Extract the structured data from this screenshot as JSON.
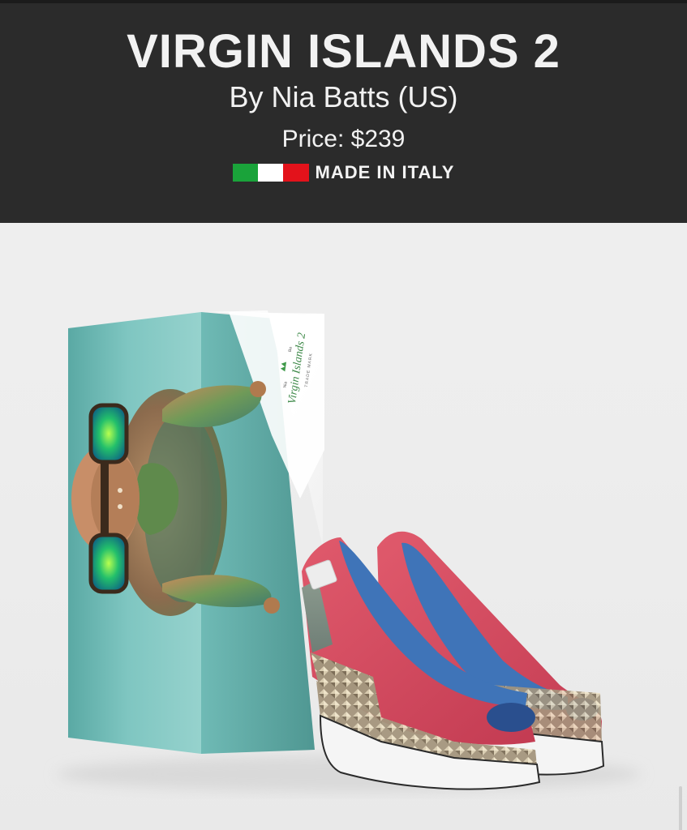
{
  "product": {
    "title": "VIRGIN ISLANDS 2",
    "designer_line": "By Nia Batts (US)",
    "price_line": "Price: $239",
    "made_in": "MADE IN ITALY",
    "flag_colors": [
      "#1aa33a",
      "#ffffff",
      "#e3121b"
    ]
  },
  "box": {
    "label_name": "Virgin Islands 2",
    "label_small_left": "Nia",
    "label_small_right": "Ba",
    "label_trademark": "TRADE MARK"
  },
  "colors": {
    "header_bg": "#2b2b2b",
    "box_teal": "#7cc4bf",
    "shoe_red": "#d9485e",
    "shoe_blue": "#3f74b8",
    "sole_white": "#f4f4f4"
  },
  "icons": {
    "crown": "crown-icon",
    "turtle_art": "turtle-with-sunglasses-illustration"
  }
}
